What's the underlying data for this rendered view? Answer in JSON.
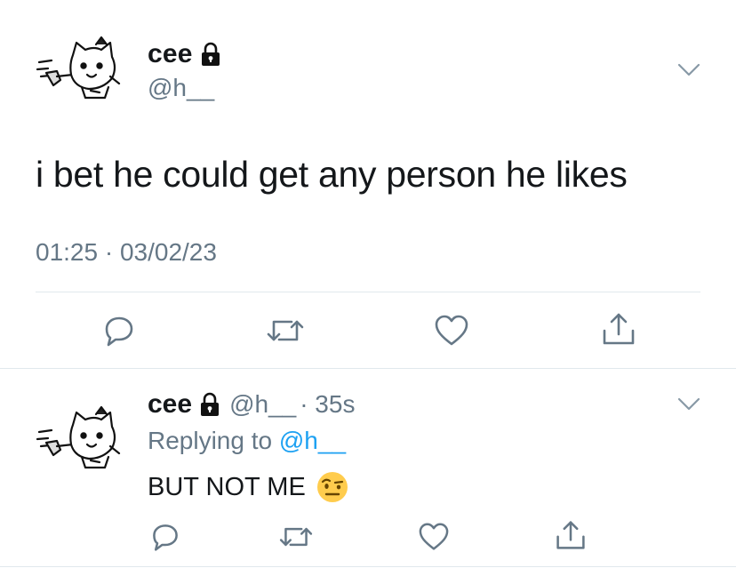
{
  "main_tweet": {
    "display_name": "cee",
    "handle": "@h__",
    "locked_icon": "lock-icon",
    "text": "i bet he could get any person he likes",
    "timestamp": "01:25 · 03/02/23",
    "menu_icon": "chevron-down-icon",
    "actions": [
      "reply-icon",
      "retweet-icon",
      "like-icon",
      "share-icon"
    ]
  },
  "reply_tweet": {
    "display_name": "cee",
    "handle": "@h__",
    "age": "· 35s",
    "replying_prefix": "Replying to",
    "replying_handle": "@h__",
    "text": "BUT NOT ME",
    "emoji_icon": "raised-eyebrow-face-icon",
    "menu_icon": "chevron-down-icon",
    "actions": [
      "reply-icon",
      "retweet-icon",
      "like-icon",
      "share-icon"
    ]
  },
  "colors": {
    "text": "#14171a",
    "muted": "#657786",
    "link": "#1da1f2",
    "divider": "#e1e8ed",
    "icon": "#657786"
  }
}
